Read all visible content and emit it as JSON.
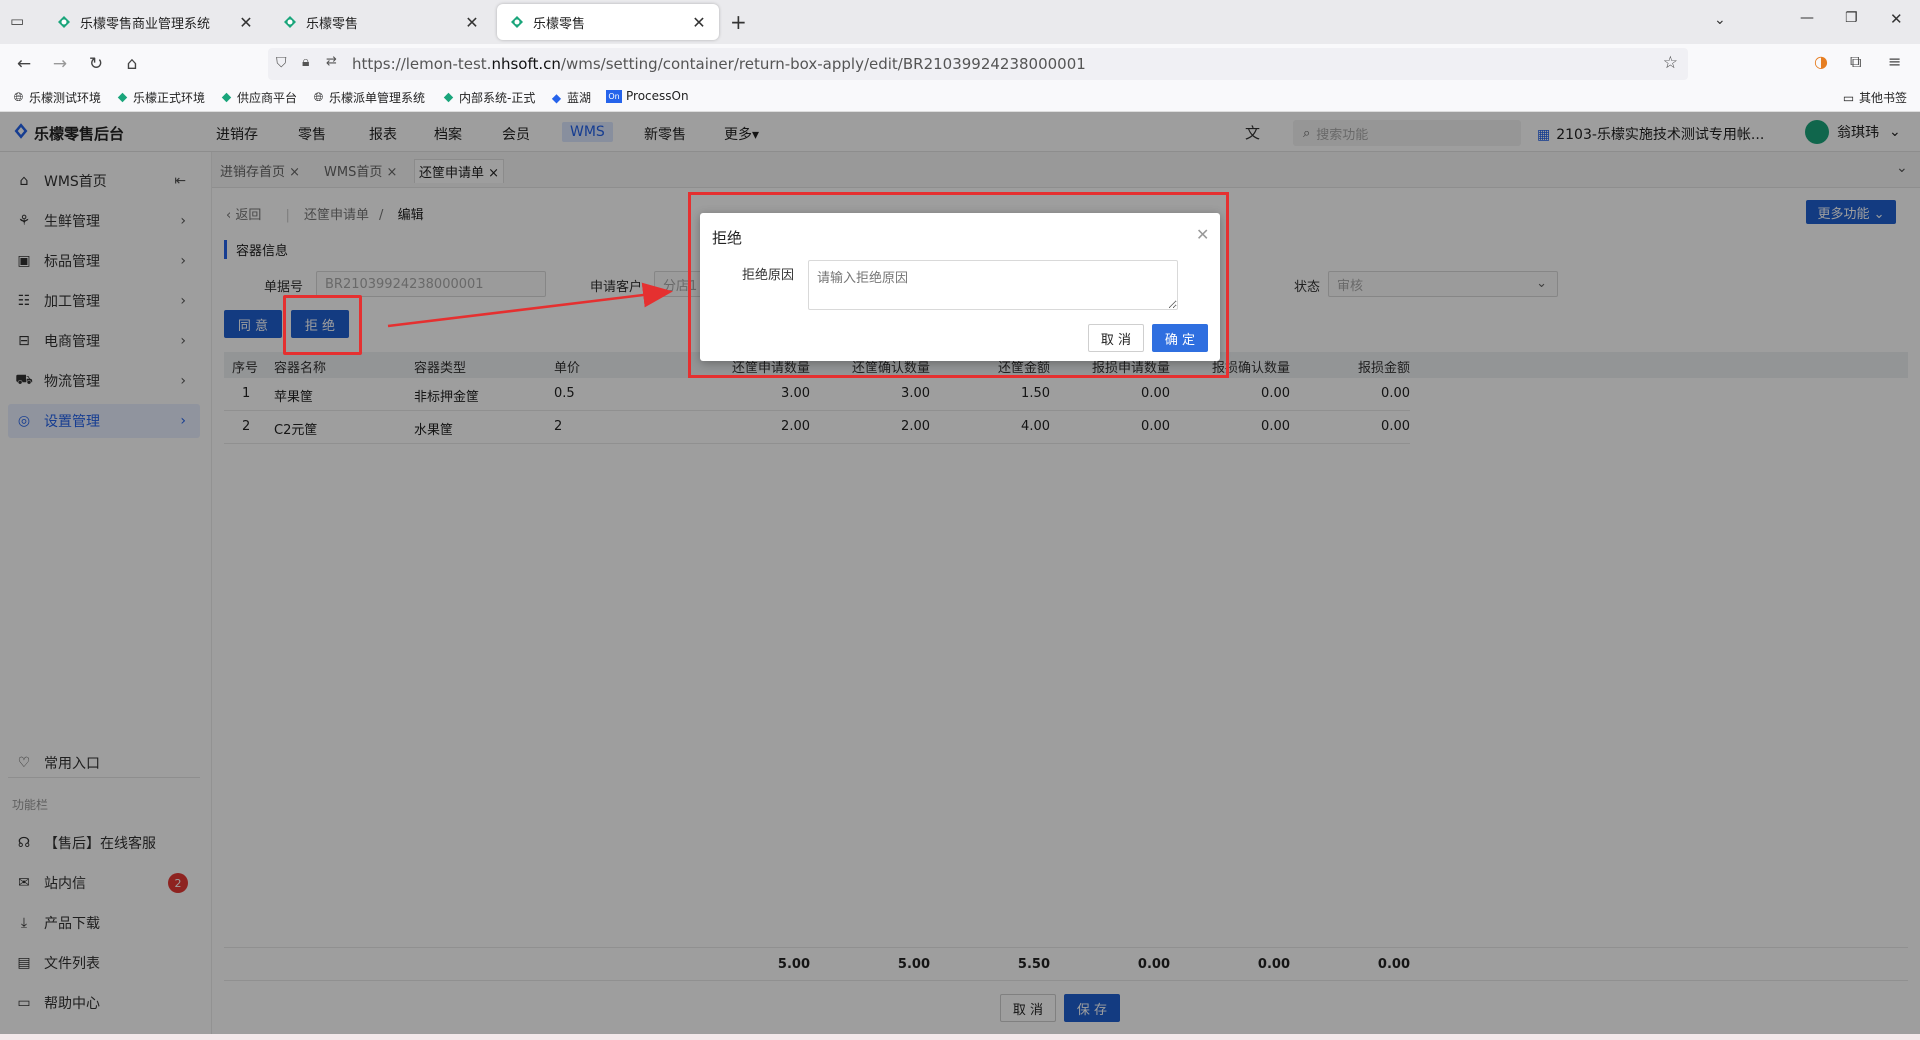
{
  "browser": {
    "tabs": [
      {
        "title": "乐檬零售商业管理系统",
        "active": false
      },
      {
        "title": "乐檬零售",
        "active": false
      },
      {
        "title": "乐檬零售",
        "active": true
      }
    ],
    "url_prefix": "https://lemon-test.",
    "url_host": "nhsoft.cn",
    "url_path": "/wms/setting/container/return-box-apply/edit/BR21039924238000001",
    "bookmarks": [
      "乐檬测试环境",
      "乐檬正式环境",
      "供应商平台",
      "乐檬派单管理系统",
      "内部系统-正式",
      "蓝湖",
      "ProcessOn"
    ],
    "other_bookmarks": "其他书签"
  },
  "app": {
    "logo": "乐檬零售后台",
    "menus": [
      "进销存",
      "零售",
      "报表",
      "档案",
      "会员",
      "WMS",
      "新零售",
      "更多▾"
    ],
    "selected_menu": "WMS",
    "search_placeholder": "搜索功能",
    "store": "2103-乐檬实施技术测试专用帐...",
    "user": "翁琪玮"
  },
  "sidebar": {
    "items": [
      "WMS首页",
      "生鲜管理",
      "标品管理",
      "加工管理",
      "电商管理",
      "物流管理",
      "设置管理"
    ],
    "selected": "设置管理",
    "common": "常用入口",
    "section_label": "功能栏",
    "bottom_items": [
      "【售后】在线客服",
      "站内信",
      "产品下载",
      "文件列表",
      "帮助中心"
    ],
    "message_badge": "2"
  },
  "tags": [
    "进销存首页 ×",
    "WMS首页 ×",
    "还筐申请单 ×"
  ],
  "breadcrumb": {
    "back": "返回",
    "parent": "还筐申请单",
    "sep": "/",
    "current": "编辑"
  },
  "more_button": "更多功能 ⌄",
  "section_title": "容器信息",
  "form": {
    "order_no_label": "单据号",
    "order_no": "BR21039924238000001",
    "customer_label": "申请客户",
    "customer": "分店1",
    "status_label": "状态",
    "status": "审核"
  },
  "actions": {
    "agree": "同 意",
    "reject": "拒 绝"
  },
  "table": {
    "headers": [
      "序号",
      "容器名称",
      "容器类型",
      "单价",
      "还筐申请数量",
      "还筐确认数量",
      "还筐金额",
      "报损申请数量",
      "报损确认数量",
      "报损金额"
    ],
    "rows": [
      [
        "1",
        "苹果筐",
        "非标押金筐",
        "0.5",
        "3.00",
        "3.00",
        "1.50",
        "0.00",
        "0.00",
        "0.00"
      ],
      [
        "2",
        "C2元筐",
        "水果筐",
        "2",
        "2.00",
        "2.00",
        "4.00",
        "0.00",
        "0.00",
        "0.00"
      ]
    ],
    "totals": [
      "5.00",
      "5.00",
      "5.50",
      "0.00",
      "0.00",
      "0.00"
    ]
  },
  "footer_buttons": {
    "cancel": "取 消",
    "save": "保 存"
  },
  "modal": {
    "title": "拒绝",
    "reason_label": "拒绝原因",
    "reason_placeholder": "请输入拒绝原因",
    "cancel": "取 消",
    "confirm": "确 定"
  },
  "colors": {
    "primary": "#1f5fd0",
    "annotation": "#e53030",
    "badge": "#e53935"
  }
}
